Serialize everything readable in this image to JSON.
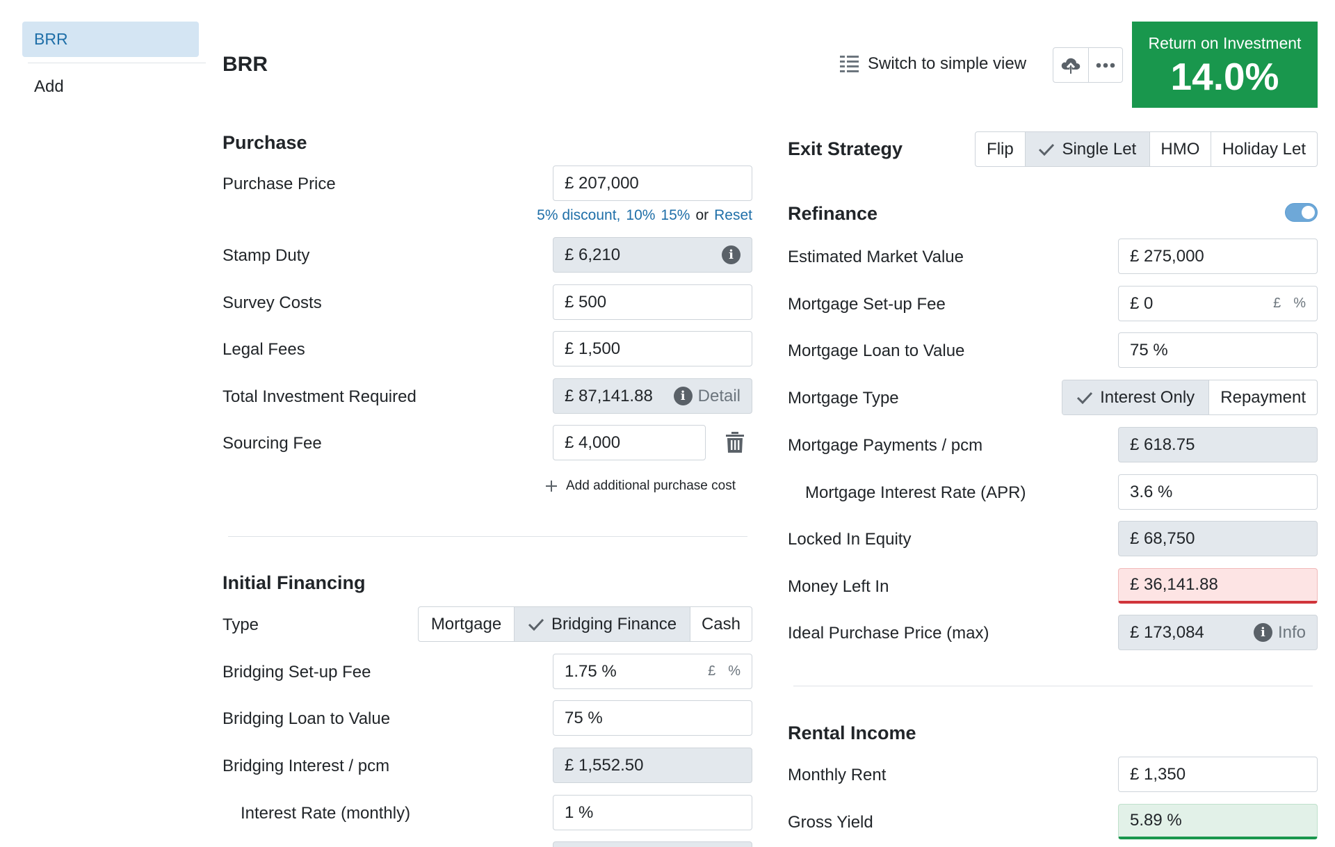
{
  "sidebar": {
    "active": "BRR",
    "add": "Add"
  },
  "header": {
    "title": "BRR",
    "switch_view": "Switch to simple view",
    "roi_label": "Return on Investment",
    "roi_value": "14.0%"
  },
  "purchase": {
    "title": "Purchase",
    "purchase_price": {
      "label": "Purchase Price",
      "value": "£ 207,000"
    },
    "discounts": {
      "d5": "5% discount,",
      "d10": "10%",
      "d15": "15%",
      "or": "or",
      "reset": "Reset"
    },
    "stamp_duty": {
      "label": "Stamp Duty",
      "value": "£ 6,210"
    },
    "survey_costs": {
      "label": "Survey Costs",
      "value": "£ 500"
    },
    "legal_fees": {
      "label": "Legal Fees",
      "value": "£ 1,500"
    },
    "total_investment": {
      "label": "Total Investment Required",
      "value": "£ 87,141.88",
      "detail": "Detail"
    },
    "sourcing_fee": {
      "label": "Sourcing Fee",
      "value": "£ 4,000"
    },
    "add_cost": "Add additional purchase cost"
  },
  "initial_financing": {
    "title": "Initial Financing",
    "type_label": "Type",
    "types": [
      "Mortgage",
      "Bridging Finance",
      "Cash"
    ],
    "active_type": "Bridging Finance",
    "setup_fee": {
      "label": "Bridging Set-up Fee",
      "value": "1.75 %",
      "unit_a": "£",
      "unit_b": "%"
    },
    "ltv": {
      "label": "Bridging Loan to Value",
      "value": "75 %"
    },
    "interest_pcm": {
      "label": "Bridging Interest / pcm",
      "value": "£ 1,552.50"
    },
    "interest_rate": {
      "label": "Interest Rate (monthly)",
      "value": "1 %"
    }
  },
  "exit_strategy": {
    "title": "Exit Strategy",
    "options": [
      "Flip",
      "Single Let",
      "HMO",
      "Holiday Let"
    ],
    "active": "Single Let"
  },
  "refinance": {
    "title": "Refinance",
    "enabled": true,
    "market_value": {
      "label": "Estimated Market Value",
      "value": "£ 275,000"
    },
    "setup_fee": {
      "label": "Mortgage Set-up Fee",
      "value": "£ 0",
      "unit_a": "£",
      "unit_b": "%"
    },
    "ltv": {
      "label": "Mortgage Loan to Value",
      "value": "75 %"
    },
    "mortgage_type": {
      "label": "Mortgage Type",
      "options": [
        "Interest Only",
        "Repayment"
      ],
      "active": "Interest Only"
    },
    "payments": {
      "label": "Mortgage Payments / pcm",
      "value": "£ 618.75"
    },
    "interest_rate": {
      "label": "Mortgage Interest Rate (APR)",
      "value": "3.6 %"
    },
    "locked_equity": {
      "label": "Locked In Equity",
      "value": "£ 68,750"
    },
    "money_left": {
      "label": "Money Left In",
      "value": "£ 36,141.88"
    },
    "ideal_price": {
      "label": "Ideal Purchase Price (max)",
      "value": "£ 173,084",
      "info": "Info"
    }
  },
  "rental_income": {
    "title": "Rental Income",
    "monthly_rent": {
      "label": "Monthly Rent",
      "value": "£ 1,350"
    },
    "gross_yield": {
      "label": "Gross Yield",
      "value": "5.89 %"
    }
  },
  "colors": {
    "accent": "#1f6fa8",
    "roi_green": "#19974d",
    "danger": "#d0343a",
    "readonly": "#e3e8ed"
  }
}
